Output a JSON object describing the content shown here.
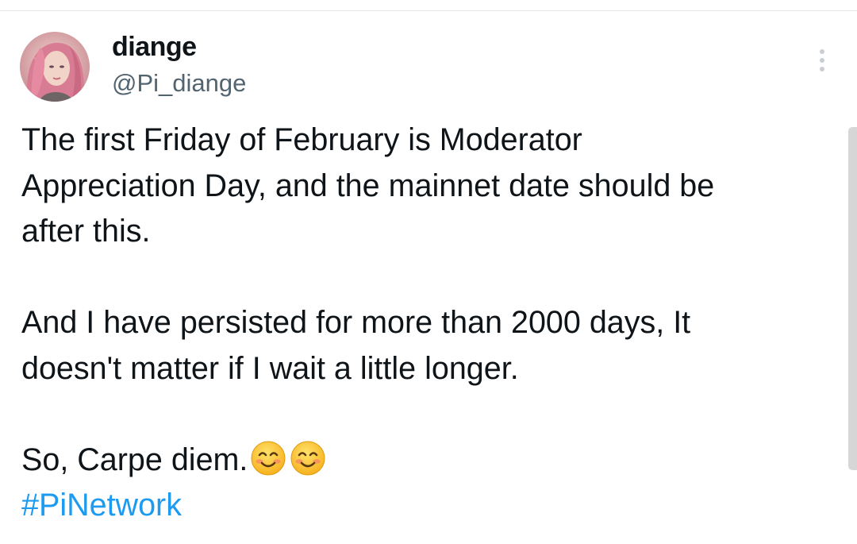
{
  "user": {
    "display_name": "diange",
    "handle": "@Pi_diange"
  },
  "tweet": {
    "paragraph_1": "The first Friday of February is Moderator\nAppreciation Day, and the mainnet date should be\nafter this.",
    "paragraph_2": "And I have persisted for more than 2000 days,  It\ndoesn't matter if I wait a little longer.",
    "paragraph_3_text": "So, Carpe diem.",
    "emojis": [
      "smiling-face-emoji",
      "smiling-face-emoji"
    ],
    "hashtag": "#PiNetwork"
  },
  "colors": {
    "text": "#0f1419",
    "secondary_text": "#536471",
    "hashtag": "#1d9bf0"
  },
  "icons": {
    "more": "more-vertical-icon"
  }
}
